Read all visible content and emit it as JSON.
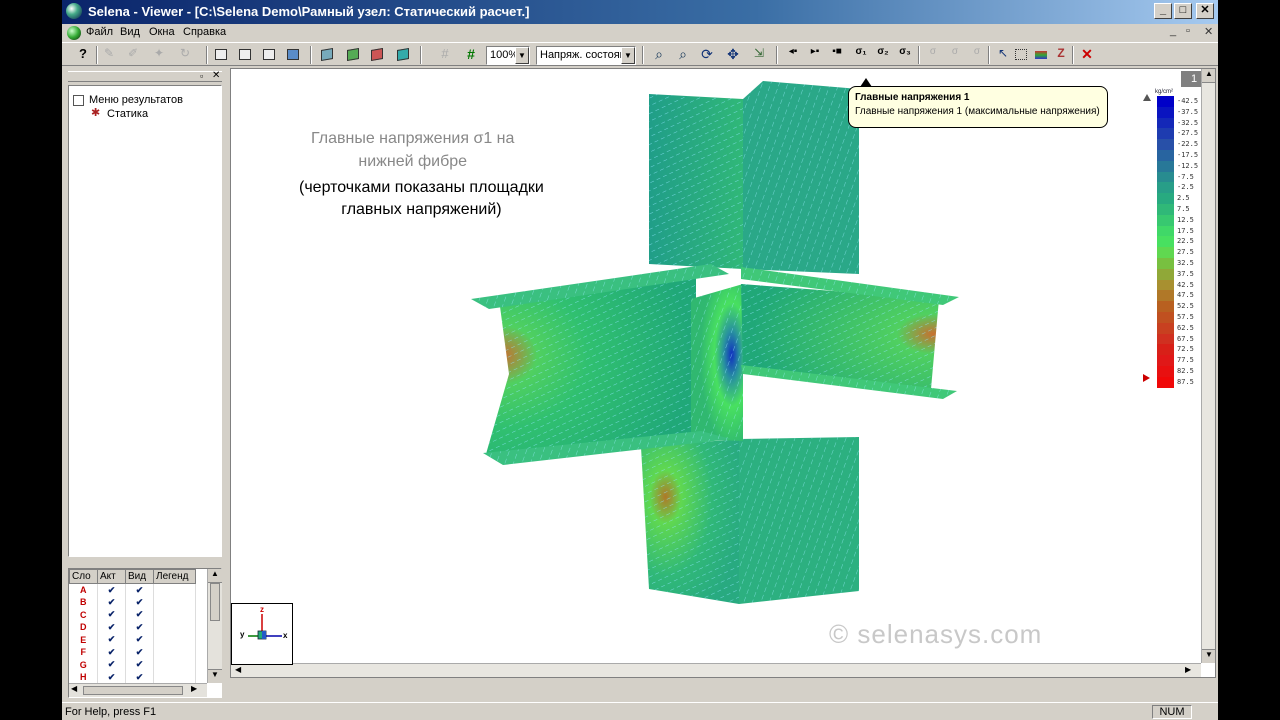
{
  "window": {
    "title": "Selena - Viewer - [C:\\Selena Demo\\Рамный узел:  Статический расчет.]",
    "min_label": "_",
    "max_label": "□",
    "close_label": "✕"
  },
  "menu": {
    "items": [
      "Файл",
      "Вид",
      "Окна",
      "Справка"
    ],
    "mdi_min": "_",
    "mdi_restore": "▫",
    "mdi_close": "✕"
  },
  "toolbar": {
    "zoom_value": "100%",
    "mode_value": "Напряж. состояни"
  },
  "tree": {
    "root": "Меню результатов",
    "child": "Статика"
  },
  "layers": {
    "headers": [
      "Сло",
      "Акт",
      "Вид",
      "Легенд"
    ],
    "rows": [
      {
        "name": "A",
        "act": "✔",
        "vis": "✔"
      },
      {
        "name": "B",
        "act": "✔",
        "vis": "✔"
      },
      {
        "name": "C",
        "act": "✔",
        "vis": "✔"
      },
      {
        "name": "D",
        "act": "✔",
        "vis": "✔"
      },
      {
        "name": "E",
        "act": "✔",
        "vis": "✔"
      },
      {
        "name": "F",
        "act": "✔",
        "vis": "✔"
      },
      {
        "name": "G",
        "act": "✔",
        "vis": "✔"
      },
      {
        "name": "H",
        "act": "✔",
        "vis": "✔"
      }
    ]
  },
  "viewport": {
    "caption_line1": "Главные напряжения σ1 на",
    "caption_line2": "нижней фибре",
    "caption_line3": "(черточками показаны площадки",
    "caption_line4": "главных напряжений)",
    "watermark": "© selenasys.com",
    "axes": {
      "z": "z",
      "y": "y",
      "x": "x"
    }
  },
  "tooltip": {
    "title": "Главные напряжения 1",
    "text": "Главные напряжения 1 (максимальные напряжения)"
  },
  "legend": {
    "page_number": "1",
    "unit": "kg/cm²",
    "values": [
      "-42.5",
      "-37.5",
      "-32.5",
      "-27.5",
      "-22.5",
      "-17.5",
      "-12.5",
      "-7.5",
      "-2.5",
      "2.5",
      "7.5",
      "12.5",
      "17.5",
      "22.5",
      "27.5",
      "32.5",
      "37.5",
      "42.5",
      "47.5",
      "52.5",
      "57.5",
      "62.5",
      "67.5",
      "72.5",
      "77.5",
      "82.5",
      "87.5"
    ],
    "colors": [
      "#0000c8",
      "#0a14c0",
      "#1428b8",
      "#1e3cb0",
      "#2850a8",
      "#2864a0",
      "#287898",
      "#288c90",
      "#289e88",
      "#28aa80",
      "#30b878",
      "#38c870",
      "#40d868",
      "#48e060",
      "#60d850",
      "#78c040",
      "#90a838",
      "#a89030",
      "#b07828",
      "#b86020",
      "#c05020",
      "#c84020",
      "#d03020",
      "#d82018",
      "#e01818",
      "#e81010",
      "#f00808"
    ]
  },
  "status": {
    "help": "For Help, press F1",
    "num": "NUM"
  }
}
